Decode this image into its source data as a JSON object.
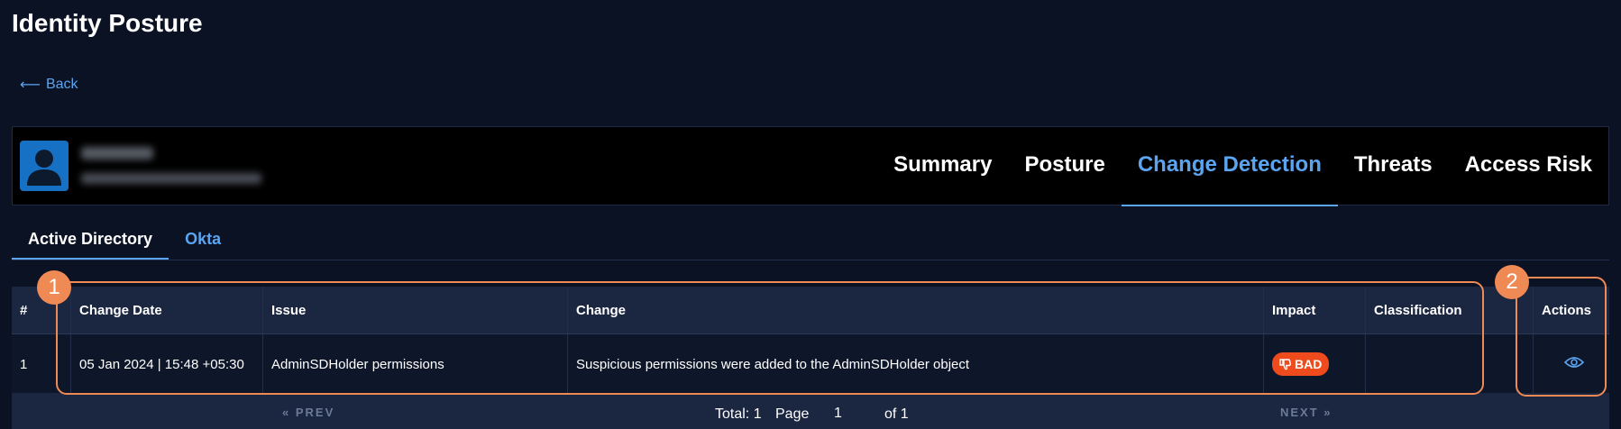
{
  "page": {
    "title": "Identity Posture",
    "back_label": "Back"
  },
  "main_tabs": [
    {
      "label": "Summary",
      "active": false
    },
    {
      "label": "Posture",
      "active": false
    },
    {
      "label": "Change Detection",
      "active": true
    },
    {
      "label": "Threats",
      "active": false
    },
    {
      "label": "Access Risk",
      "active": false
    }
  ],
  "sub_tabs": [
    {
      "label": "Active Directory",
      "active": true
    },
    {
      "label": "Okta",
      "active": false
    }
  ],
  "table": {
    "headers": [
      "#",
      "Change Date",
      "Issue",
      "Change",
      "Impact",
      "Classification",
      "Actions"
    ],
    "rows": [
      {
        "num": "1",
        "date": "05 Jan 2024 | 15:48 +05:30",
        "issue": "AdminSDHolder permissions",
        "change": "Suspicious permissions were added to the AdminSDHolder object",
        "impact": "BAD",
        "classification": ""
      }
    ]
  },
  "pagination": {
    "prev": "PREV",
    "next": "NEXT",
    "total": "Total: 1",
    "page_label": "Page",
    "page_value": "1",
    "of_label": "of 1"
  },
  "callouts": [
    "1",
    "2"
  ],
  "colors": {
    "accent": "#5ba4f0",
    "bad": "#f04b1c",
    "callout": "#f08a55",
    "background": "#0b1224"
  }
}
